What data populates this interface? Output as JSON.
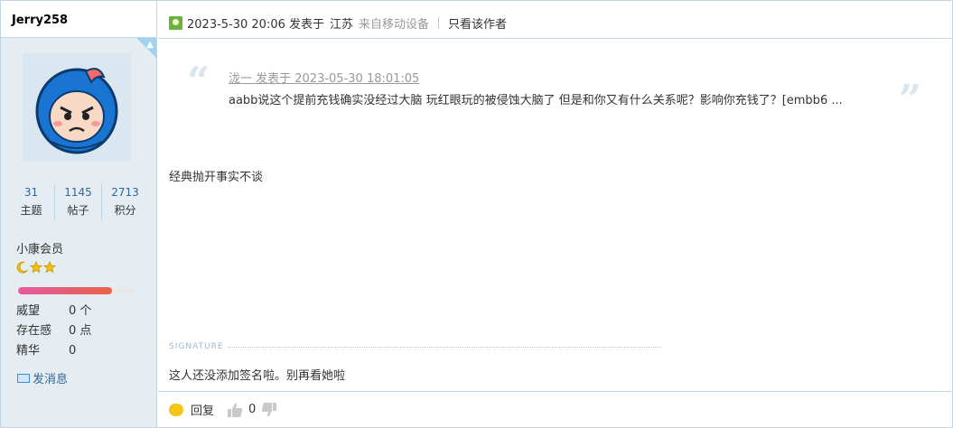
{
  "sidebar": {
    "username": "Jerry258",
    "stats": [
      {
        "num": "31",
        "label": "主题"
      },
      {
        "num": "1145",
        "label": "帖子"
      },
      {
        "num": "2713",
        "label": "积分"
      }
    ],
    "rank": "小康会员",
    "rank_progress": 0.8,
    "info": [
      {
        "key": "威望",
        "value": "0 个"
      },
      {
        "key": "存在感",
        "value": "0 点"
      },
      {
        "key": "精华",
        "value": "0"
      }
    ],
    "send_message": "发消息"
  },
  "post": {
    "time": "2023-5-30 20:06 发表于",
    "location": "江苏",
    "device": "来自移动设备",
    "only_author": "只看该作者",
    "quote": {
      "header": "泷一 发表于 2023-05-30 18:01:05",
      "text": "aabb说这个提前充钱确实没经过大脑 玩红眼玩的被侵蚀大脑了 但是和你又有什么关系呢？影响你充钱了？[embb6 ..."
    },
    "content": "经典抛开事实不谈",
    "signature_label": "SIGNATURE",
    "signature": "这人还没添加签名啦。别再看她啦",
    "reply_label": "回复",
    "like_count": "0"
  },
  "colors": {
    "border": "#c2d5e3",
    "sidebar_bg": "#e5edf2",
    "link": "#336699"
  }
}
